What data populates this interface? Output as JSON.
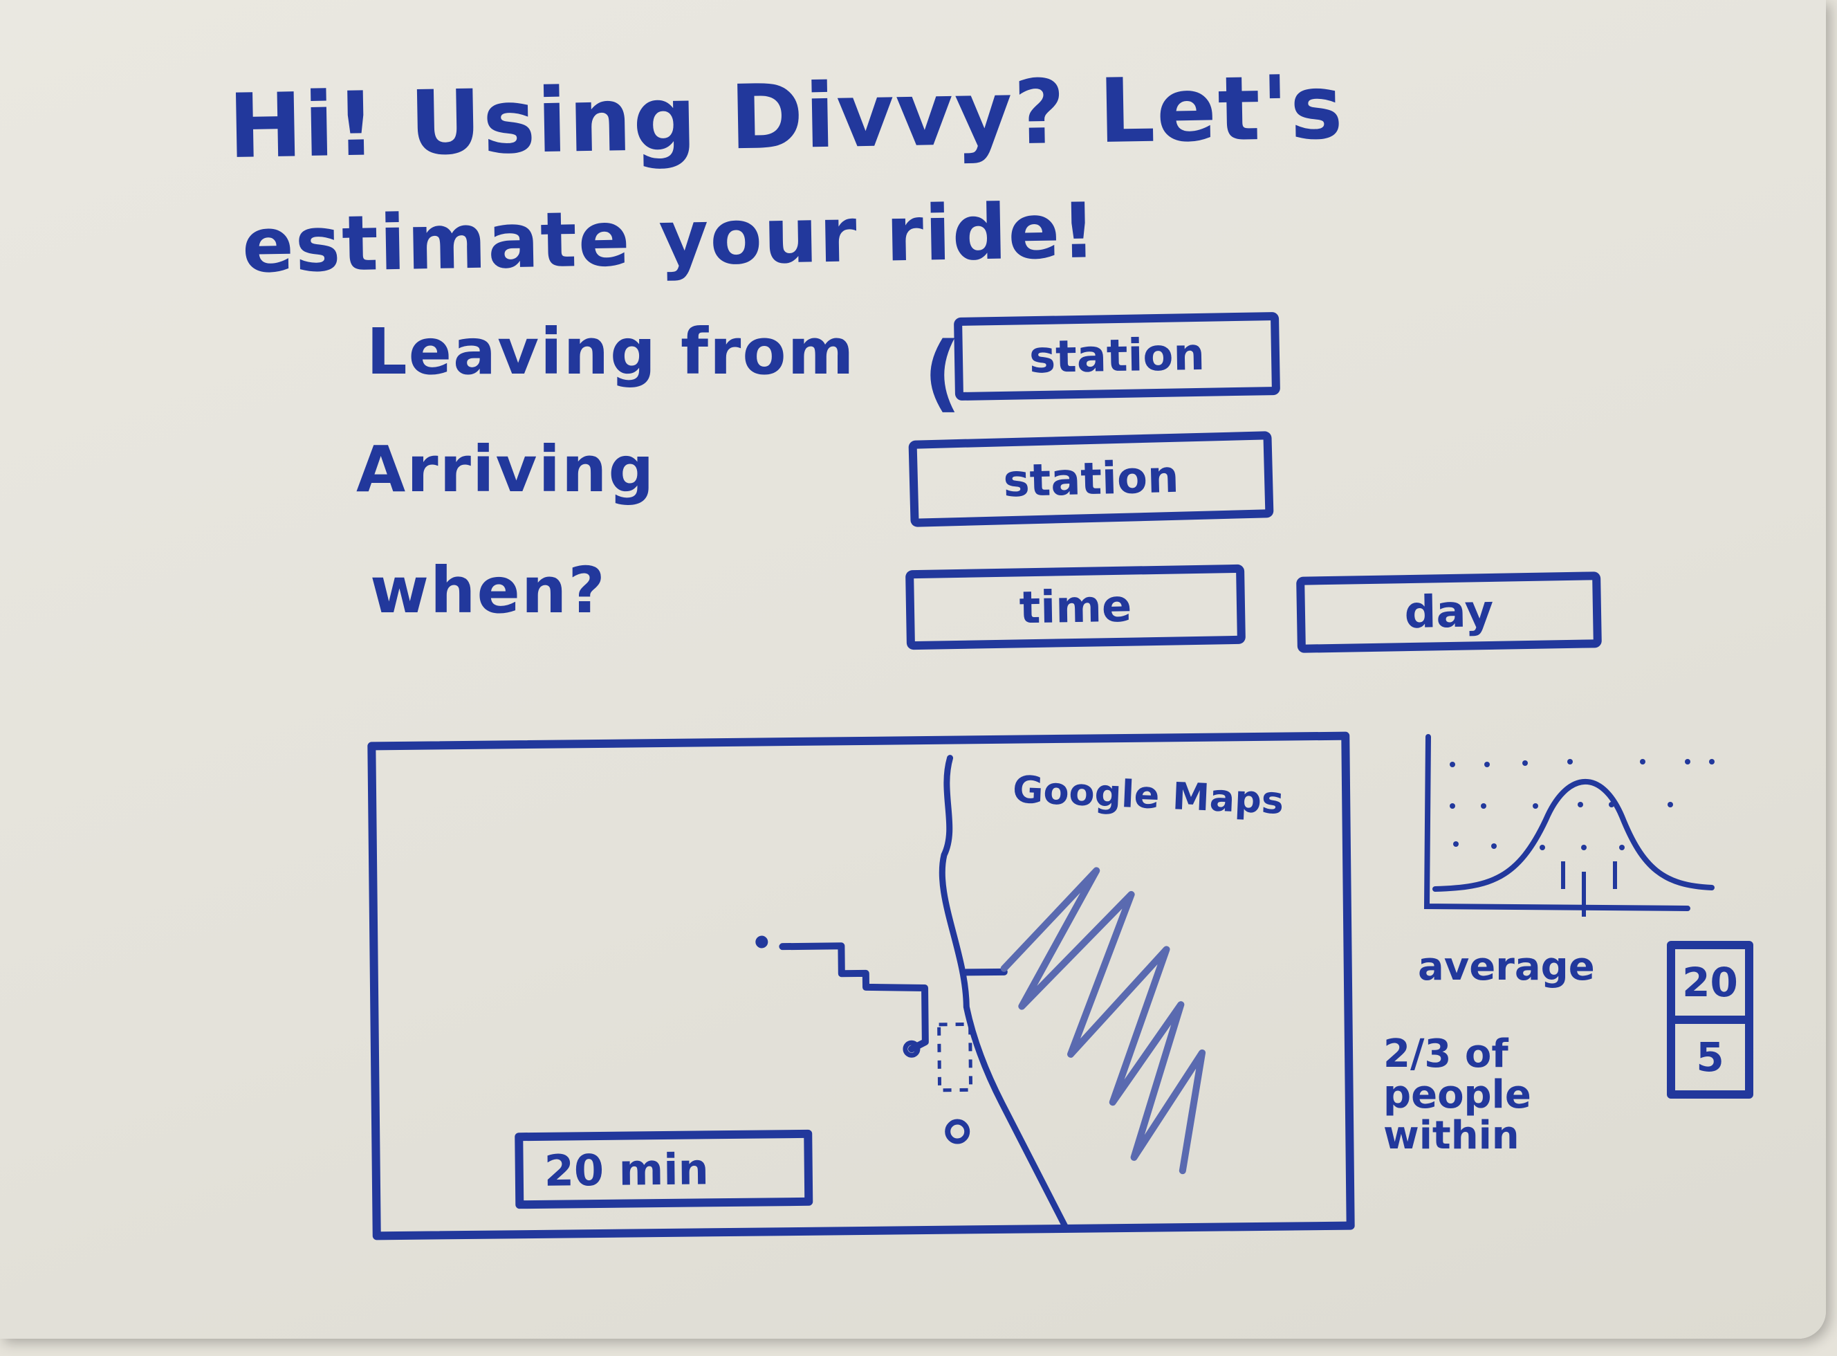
{
  "header": {
    "line1": "Hi! Using Divvy? Let's",
    "line2": "estimate your ride!"
  },
  "form": {
    "leaving_label": "Leaving from",
    "leaving_field": "station",
    "arriving_label": "Arriving",
    "arriving_field": "station",
    "when_label": "when?",
    "time_field": "time",
    "day_field": "day"
  },
  "map": {
    "provider_label": "Google Maps",
    "duration_label": "20 min"
  },
  "stats": {
    "average_label": "average",
    "average_value": "20",
    "within_label": "2/3 of people within",
    "within_value": "5"
  },
  "colors": {
    "ink": "#22389c",
    "board": "#e6e3da"
  }
}
